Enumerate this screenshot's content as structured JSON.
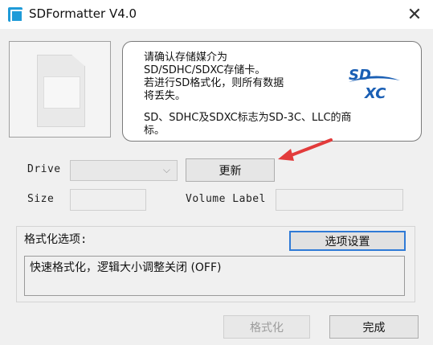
{
  "window": {
    "title": "SDFormatter V4.0",
    "close_glyph": "✕"
  },
  "info": {
    "lines": [
      "请确认存储媒介为",
      "SD/SDHC/SDXC存储卡。",
      "若进行SD格式化，则所有数据",
      "将丢失。",
      "SD、SDHC及SDXC标志为SD-3C、LLC的商",
      "标。"
    ],
    "logo_top": "SD",
    "logo_bottom": "XC"
  },
  "drive": {
    "label": "Drive",
    "selected": "",
    "refresh_button": "更新"
  },
  "size": {
    "label": "Size",
    "value": ""
  },
  "volume": {
    "label": "Volume Label",
    "value": ""
  },
  "format_options": {
    "title": "格式化选项:",
    "settings_button": "选项设置",
    "summary": "快速格式化，逻辑大小调整关闭 (OFF)"
  },
  "actions": {
    "format_button": "格式化",
    "done_button": "完成"
  },
  "colors": {
    "accent_arrow": "#e23b3b",
    "sd_logo": "#1a5fb4",
    "primary_button_border": "#2f7ad6"
  }
}
